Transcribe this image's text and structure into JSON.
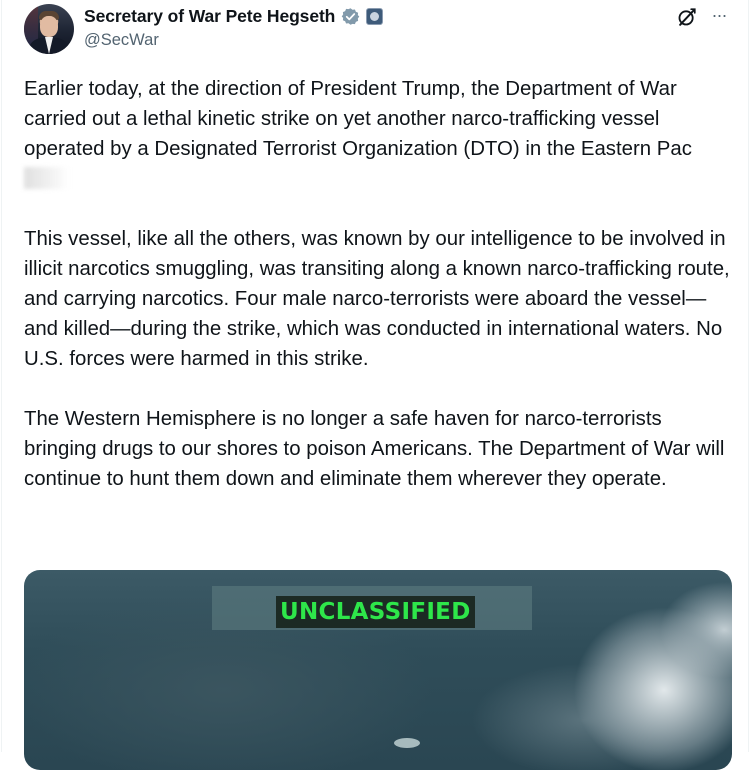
{
  "author": {
    "display_name": "Secretary of War Pete Hegseth",
    "handle": "@SecWar"
  },
  "header_actions": {
    "grok": "grok-icon",
    "more": "···"
  },
  "tweet": {
    "paragraphs": [
      "Earlier today, at the direction of President Trump, the Department of War carried out a lethal kinetic strike on yet another narco-trafficking vessel operated by a Designated Terrorist Organization (DTO) in the Eastern Pac",
      "This vessel, like all the others, was known by our intelligence to be involved in illicit narcotics smuggling, was transiting along a known narco-trafficking route, and carrying narcotics. Four male narco-terrorists were aboard the vessel—and killed—during the strike, which was conducted in international waters. No U.S. forces were harmed in this strike.",
      "The Western Hemisphere is no longer a safe haven for narco-terrorists bringing drugs to our shores to poison Americans. The Department of War will continue to hunt them down and eliminate them wherever they operate."
    ]
  },
  "media": {
    "classification_label": "UNCLASSIFIED",
    "label_color": "#2ee64a"
  },
  "colors": {
    "verified_badge": "#829aab",
    "handle_text": "#536471"
  }
}
